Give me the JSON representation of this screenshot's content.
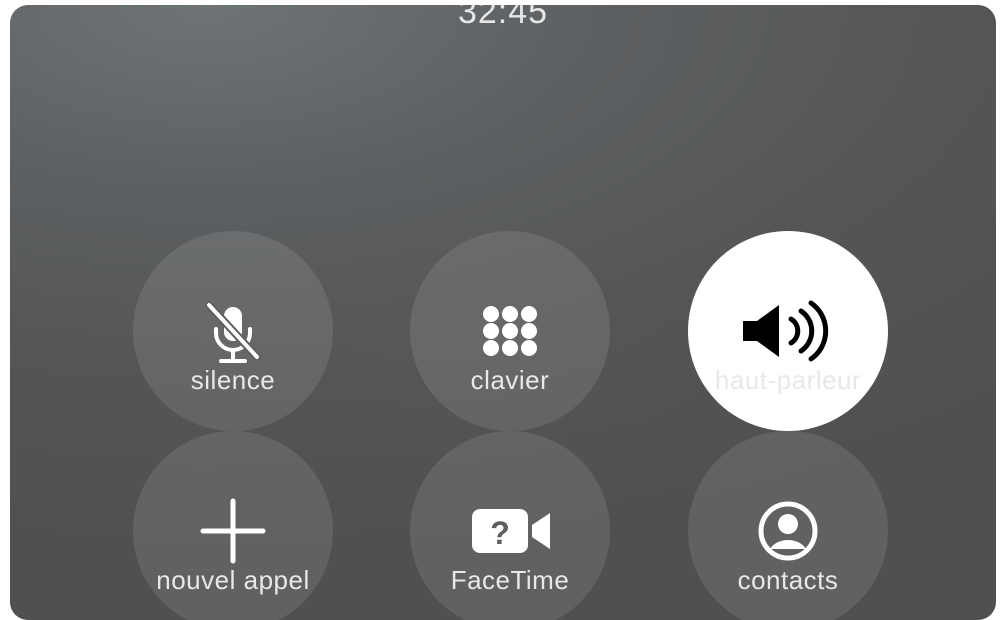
{
  "call": {
    "timer": "32:45"
  },
  "controls": [
    {
      "label": "silence",
      "icon": "mic-slash-icon",
      "active": false
    },
    {
      "label": "clavier",
      "icon": "keypad-icon",
      "active": false
    },
    {
      "label": "haut-parleur",
      "icon": "speaker-icon",
      "active": true
    },
    {
      "label": "nouvel appel",
      "icon": "plus-icon",
      "active": false
    },
    {
      "label": "FaceTime",
      "icon": "facetime-icon",
      "active": false
    },
    {
      "label": "contacts",
      "icon": "contacts-icon",
      "active": false
    }
  ],
  "colors": {
    "background": "#555657",
    "button": "#6b6c6d",
    "active_button": "#ffffff",
    "text": "#e8e8e8"
  }
}
